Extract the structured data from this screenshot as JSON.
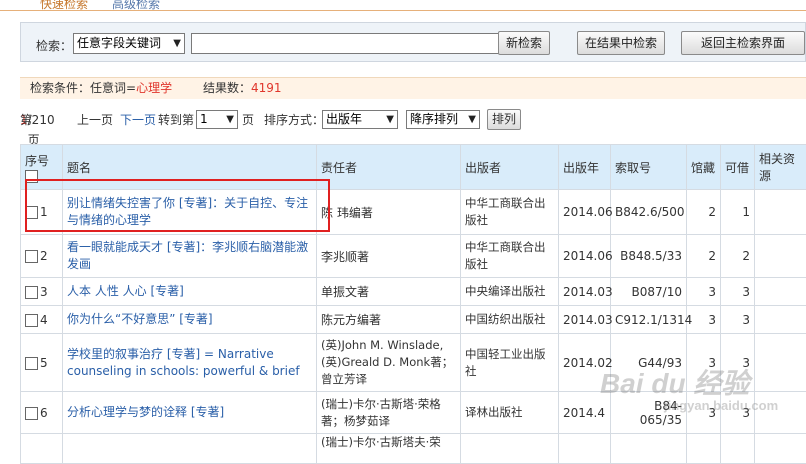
{
  "tabs": {
    "active": "快速检索",
    "other": "高级检索"
  },
  "search": {
    "label": "检索：",
    "field_selected": "任意字段关键词",
    "keyword_value": "",
    "btn_new": "新检索",
    "btn_within": "在结果中检索",
    "btn_back": "返回主检索界面"
  },
  "condition": {
    "label": "检索条件：任意词=",
    "term": "心理学",
    "hits_label": "结果数：",
    "hits_count": "4191"
  },
  "pager": {
    "page_prefix": "第",
    "current": "1",
    "page_suffix": "/210页",
    "prev": "上一页",
    "next": "下一页",
    "goto_label": "转到第",
    "goto_value": "1",
    "page_unit": "页",
    "sort_label": "排序方式：",
    "sort_field": "出版年",
    "sort_order": "降序排列",
    "sort_button": "排列"
  },
  "table": {
    "headers": {
      "seq": "序号",
      "title": "题名",
      "author": "责任者",
      "publisher": "出版者",
      "year": "出版年",
      "callno": "索取号",
      "holdings": "馆藏",
      "available": "可借",
      "resources": "相关资源"
    },
    "rows": [
      {
        "seq": "1",
        "title": "别让情绪失控害了你 [专著]：关于自控、专注与情绪的心理学",
        "author": "陈 玮编著",
        "publisher": "中华工商联合出版社",
        "year": "2014.06",
        "callno": "B842.6/500",
        "holdings": "2",
        "available": "1"
      },
      {
        "seq": "2",
        "title": "看一眼就能成天才 [专著]：李兆顺右脑潜能激发画",
        "author": "李兆顺著",
        "publisher": "中华工商联合出版社",
        "year": "2014.06",
        "callno": "B848.5/33",
        "holdings": "2",
        "available": "2"
      },
      {
        "seq": "3",
        "title": "人本 人性 人心 [专著]",
        "author": "单振文著",
        "publisher": "中央编译出版社",
        "year": "2014.03",
        "callno": "B087/10",
        "holdings": "3",
        "available": "3"
      },
      {
        "seq": "4",
        "title": "你为什么“不好意思” [专著]",
        "author": "陈元方编著",
        "publisher": "中国纺织出版社",
        "year": "2014.03",
        "callno": "C912.1/1314",
        "holdings": "3",
        "available": "3"
      },
      {
        "seq": "5",
        "title": "学校里的叙事治疗 [专著] = Narrative counseling in schools: powerful & brief",
        "author": "(英)John M. Winslade, (英)Greald D. Monk著；曾立芳译",
        "publisher": "中国轻工业出版社",
        "year": "2014.02",
        "callno": "G44/93",
        "holdings": "3",
        "available": "3"
      },
      {
        "seq": "6",
        "title": "分析心理学与梦的诠释 [专著]",
        "author": "(瑞士)卡尔·古斯塔·荣格著；杨梦茹译",
        "publisher": "译林出版社",
        "year": "2014.4",
        "callno": "B84-065/35",
        "holdings": "3",
        "available": "3"
      },
      {
        "seq": "",
        "title": "",
        "author": "(瑞士)卡尔·古斯塔夫·荣",
        "publisher": "",
        "year": "",
        "callno": "",
        "holdings": "",
        "available": ""
      }
    ]
  },
  "watermark": {
    "text": "Bai du 经验",
    "sub": "jingyan.baidu.com"
  }
}
